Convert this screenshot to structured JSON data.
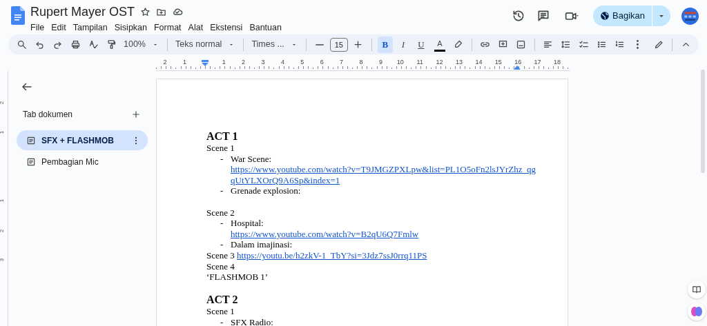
{
  "document": {
    "title": "Rupert Mayer OST"
  },
  "menu": [
    "File",
    "Edit",
    "Tampilan",
    "Sisipkan",
    "Format",
    "Alat",
    "Ekstensi",
    "Bantuan"
  ],
  "share_button": {
    "label": "Bagikan"
  },
  "toolbar": {
    "zoom": "100%",
    "style": "Teks normal",
    "font": "Times ...",
    "font_size": "15",
    "format_buttons": [
      {
        "label": "B",
        "selected": true
      },
      {
        "label": "I",
        "selected": false
      },
      {
        "label": "U",
        "selected": false
      }
    ],
    "text_color": "A"
  },
  "ruler": {
    "labels": [
      "2",
      "1",
      "1",
      "2",
      "3",
      "4",
      "5",
      "6",
      "7",
      "8",
      "9",
      "10",
      "11",
      "12",
      "13",
      "14",
      "15",
      "16",
      "17",
      "18"
    ]
  },
  "vertical_ruler": {
    "labels": [
      "2",
      "1",
      "1",
      "2",
      "3"
    ]
  },
  "sidebar": {
    "heading": "Tab dokumen",
    "tabs": [
      {
        "label": "SFX + FLASHMOB",
        "selected": true
      },
      {
        "label": "Pembagian Mic",
        "selected": false
      }
    ]
  },
  "body": [
    {
      "kind": "heading",
      "text": "ACT 1"
    },
    {
      "kind": "line",
      "text": "Scene 1"
    },
    {
      "kind": "bullet",
      "marker": "-",
      "text": "War Scene:",
      "link": "https://www.youtube.com/watch?v=T9JMGZPXLpw&list=PL1O5oFn2lsJYrZhz_qgqUtYLXOrQ9A6Sp&index=1"
    },
    {
      "kind": "bullet",
      "marker": "-",
      "text": "Grenade explosion:"
    },
    {
      "kind": "blank"
    },
    {
      "kind": "line",
      "text": "Scene 2"
    },
    {
      "kind": "bullet",
      "marker": "-",
      "text": "Hospital:",
      "link": "https://www.youtube.com/watch?v=B2qU6Q7Fmlw"
    },
    {
      "kind": "bullet",
      "marker": "-",
      "text": "Dalam imajinasi:"
    },
    {
      "kind": "line",
      "text": "Scene 3",
      "link": "https://youtu.be/h2zkV-1_TbY?si=3Jdz7ssJ0rrq11PS"
    },
    {
      "kind": "line",
      "text": "Scene 4"
    },
    {
      "kind": "line",
      "text": "‘FLASHMOB 1’"
    },
    {
      "kind": "blank"
    },
    {
      "kind": "heading",
      "text": "ACT 2"
    },
    {
      "kind": "line",
      "text": "Scene 1"
    },
    {
      "kind": "bullet",
      "marker": "-",
      "text": "SFX Radio:"
    }
  ]
}
